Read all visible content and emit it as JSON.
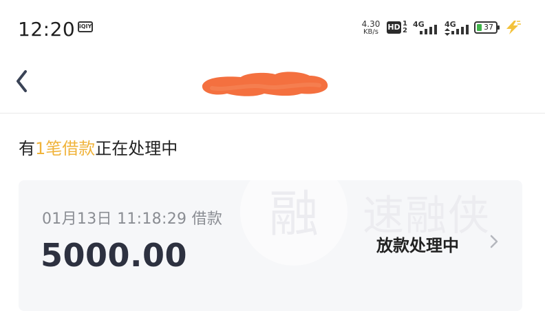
{
  "status_bar": {
    "time": "12:20",
    "app_icon": "iqiyi-icon",
    "app_icon_text": "iQIY",
    "net_speed_value": "4.30",
    "net_speed_unit": "KB/s",
    "hd_label": "HD",
    "sim_numbers": [
      "1",
      "2"
    ],
    "signal_1_label": "4G",
    "signal_2_label": "4G",
    "battery_percent": "37",
    "charging_icon": "lightning-bolt-icon",
    "colors": {
      "battery_fill": "#3fb44a",
      "charging": "#f3c23b"
    }
  },
  "nav": {
    "back_icon": "chevron-left-icon",
    "title_redacted": true,
    "redaction_color": "#f4703f"
  },
  "notice": {
    "prefix": "有",
    "highlight": "1笔借款",
    "suffix": "正在处理中",
    "highlight_color": "#f0b33a"
  },
  "loans": [
    {
      "date_time": "01月13日 11:18:29 借款",
      "amount": "5000.00",
      "status": "放款处理中",
      "arrow_icon": "chevron-right-icon"
    }
  ],
  "watermark": {
    "logo_char": "融",
    "brand": "速融侠"
  }
}
